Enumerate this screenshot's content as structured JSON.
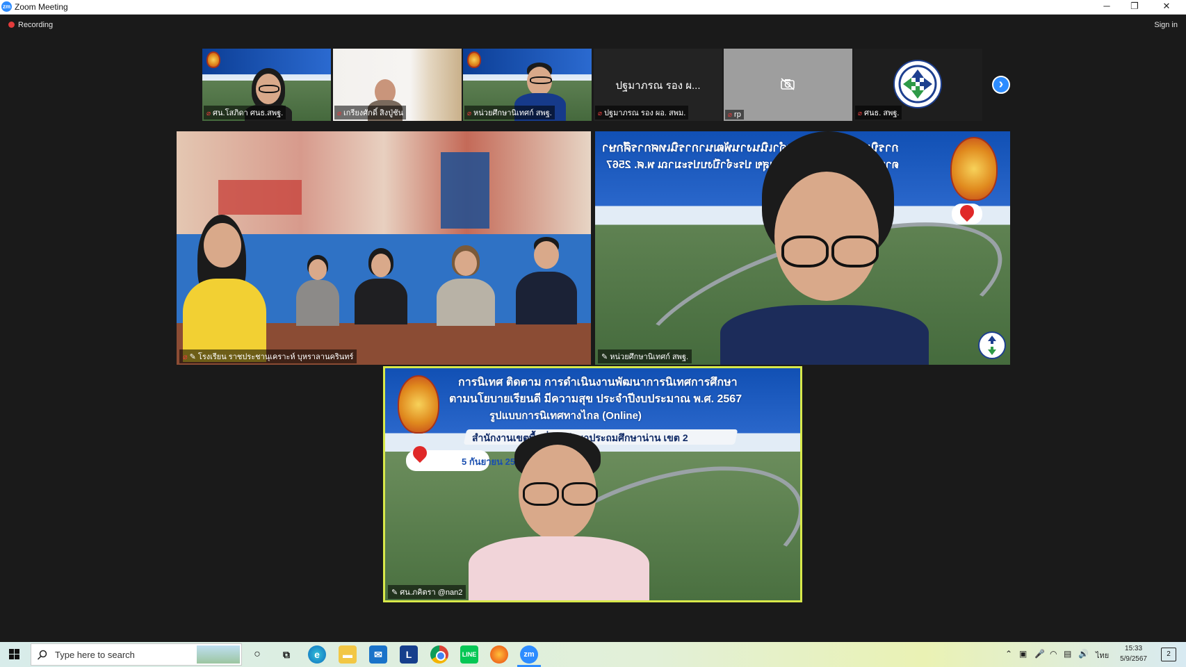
{
  "window": {
    "app_badge": "zm",
    "title": "Zoom Meeting",
    "minimize": "─",
    "restore": "❐",
    "close": "✕"
  },
  "meeting": {
    "recording_label": "Recording",
    "signin_label": "Sign in",
    "next_page": "›",
    "thumbnails": [
      {
        "name": "ศน.โสภิดา ศนธ.สพฐ."
      },
      {
        "name": "เกรียงศักดิ์ สิงปู่ชัน"
      },
      {
        "name": "หน่วยศึกษานิเทศก์ สพฐ."
      },
      {
        "name": "ปฐมาภรณ รอง ผอ. สพม.",
        "display_text": "ปฐมาภรณ รอง ผ..."
      },
      {
        "name": "rp"
      },
      {
        "name": "ศนธ. สพฐ."
      }
    ],
    "tiles": [
      {
        "name": "โรงเรียน ราชประชานุเคราะห์ บุหราลานครินทร์"
      },
      {
        "name": "หน่วยศึกษานิเทศก์ สพฐ."
      },
      {
        "name": "ศน.ภคิตรา @nan2"
      }
    ],
    "slide": {
      "line1": "การนิเทศ ติดตาม การดำเนินงานพัฒนาการนิเทศการศึกษา",
      "line2": "ตามนโยบายเรียนดี มีความสุข ประจำปีงบประมาณ พ.ศ. 2567",
      "line3": "รูปแบบการนิเทศทางไกล (Online)",
      "line4": "สำนักงานเขตพื้นที่การศึกษาประถมศึกษาน่าน เขต 2",
      "date": "5 กันยายน 2567",
      "unit": "หน่วยศึกษานิเทศก์"
    }
  },
  "taskbar": {
    "search_placeholder": "Type here to search",
    "apps": [
      "edge",
      "file-explorer",
      "mail",
      "L",
      "chrome",
      "line",
      "firefox",
      "zoom"
    ],
    "zoom_label": "zm",
    "line_label": "L",
    "language": "ไทย",
    "time": "15:33",
    "date": "5/9/2567",
    "notifications": "2"
  }
}
